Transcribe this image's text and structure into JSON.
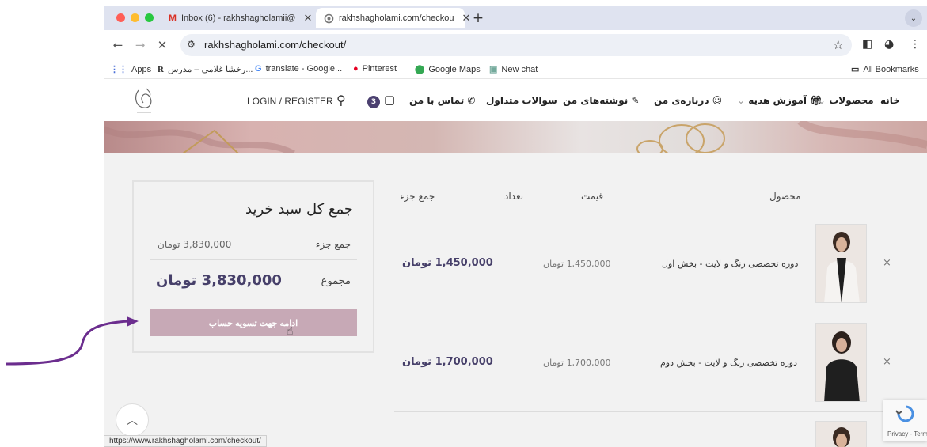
{
  "browser": {
    "tabs": [
      {
        "title": "Inbox (6) - rakhshagholamii@",
        "icon": "gmail-icon",
        "active": false
      },
      {
        "title": "rakhshagholami.com/checkou",
        "icon": "loading-icon",
        "active": true
      }
    ],
    "url": "rakhshagholami.com/checkout/",
    "bookmarks": [
      {
        "label": "Apps",
        "icon": "apps-grid-icon"
      },
      {
        "label": "رخشا غلامی – مدرس...",
        "icon": "R"
      },
      {
        "label": "translate - Google...",
        "icon": "google-icon"
      },
      {
        "label": "Pinterest",
        "icon": "pinterest-icon"
      },
      {
        "label": "Google Maps",
        "icon": "maps-pin-icon"
      },
      {
        "label": "New chat",
        "icon": "chat-icon"
      }
    ],
    "all_bookmarks": "All Bookmarks",
    "status_url": "https://www.rakhshagholami.com/checkout/"
  },
  "site": {
    "nav": {
      "home": "خانه",
      "products": "محصولات",
      "free_training": "آموزش هدیه",
      "about": "درباره‌ی من",
      "posts": "نوشته‌های من",
      "faq": "سوالات متداول",
      "contact": "تماس با من",
      "login": "LOGIN / REGISTER",
      "cart_count": "3"
    },
    "colors": {
      "accent": "#47406a",
      "button": "#c7a9b6"
    }
  },
  "cart": {
    "headers": {
      "product": "محصول",
      "price": "قیمت",
      "quantity": "تعداد",
      "subtotal": "جمع جزء"
    },
    "items": [
      {
        "title": "دوره تخصصی رنگ و لایت - بخش اول",
        "price": "1,450,000 تومان",
        "subtotal": "1,450,000 تومان",
        "remove": "×"
      },
      {
        "title": "دوره تخصصی رنگ و لایت - بخش دوم",
        "price": "1,700,000 تومان",
        "subtotal": "1,700,000 تومان",
        "remove": "×"
      }
    ]
  },
  "totals": {
    "title": "جمع کل سبد خرید",
    "subtotal_label": "جمع جزء",
    "subtotal_value": "3,830,000 تومان",
    "total_label": "مجموع",
    "total_value": "3,830,000 تومان",
    "checkout_button": "ادامه جهت تسویه حساب"
  },
  "recaptcha": "Privacy - Terms"
}
